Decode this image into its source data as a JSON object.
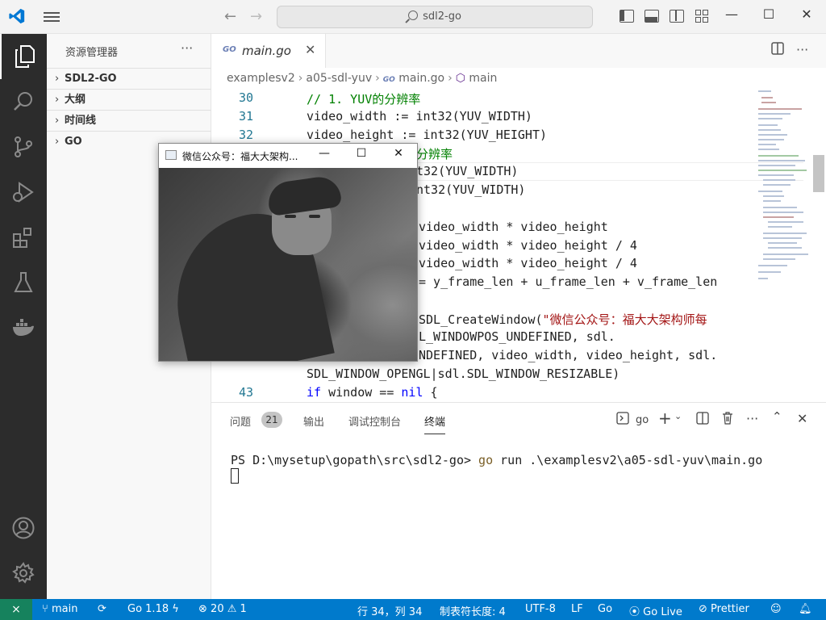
{
  "titlebar": {
    "search_text": "sdl2-go"
  },
  "sidebar": {
    "title": "资源管理器",
    "more": "···",
    "sections": [
      {
        "label": "SDL2-GO"
      },
      {
        "label": "大纲"
      },
      {
        "label": "时间线"
      },
      {
        "label": "GO"
      }
    ]
  },
  "tab": {
    "icon_text": "GO",
    "name": "main.go",
    "close": "✕"
  },
  "breadcrumb": {
    "items": [
      "examplesv2",
      "a05-sdl-yuv",
      "main.go",
      "main"
    ],
    "go_icon_text": "GO"
  },
  "editor": {
    "line_numbers": {
      "l30": "30",
      "l31": "31",
      "l32": "32",
      "l43": "43"
    },
    "lines": {
      "c30": "// 1. YUV的分辨率",
      "c31": "video_width := int32(YUV_WIDTH)",
      "c32": "video_height := int32(YUV_HEIGHT)",
      "c33": "分辨率",
      "c34": "t32(YUV_WIDTH)",
      "c35": "nt32(YUV_WIDTH)",
      "c37": "video_width * video_height",
      "c38": "video_width * video_height / 4",
      "c39": "video_width * video_height / 4",
      "c40": "= y_frame_len + u_frame_len + v_frame_len",
      "c42a": "SDL_CreateWindow(",
      "c42b": "\"微信公众号：福大大架构师每",
      "c42c": "L_WINDOWPOS_UNDEFINED, sdl.",
      "c42d": "NDEFINED, video_width, video_height, sdl.",
      "c42e": "SDL_WINDOW_OPENGL|sdl.SDL_WINDOW_RESIZABLE)",
      "c43kw1": "if",
      "c43a": " window == ",
      "c43kw2": "nil",
      "c43b": " {"
    }
  },
  "sdl_window": {
    "title": "微信公众号：福大大架构...",
    "minimize": "—",
    "maximize": "☐",
    "close": "✕"
  },
  "panel": {
    "tabs": [
      "问题",
      "输出",
      "调试控制台",
      "终端"
    ],
    "problems_count": "21",
    "active_tab": "终端",
    "terminal_shell": "go",
    "terminal_prompt": "PS D:\\mysetup\\gopath\\src\\sdl2-go> ",
    "terminal_cmd": "go",
    "terminal_args": " run .\\examplesv2\\a05-sdl-yuv\\main.go"
  },
  "status": {
    "branch": "main",
    "go_version": "Go 1.18",
    "errors": "20",
    "warnings": "1",
    "position": "行 34，列 34",
    "tab_size": "制表符长度: 4",
    "encoding": "UTF-8",
    "eol": "LF",
    "language": "Go",
    "live": "Go Live",
    "prettier": "Prettier"
  },
  "colors": {
    "status_bar": "#007acc",
    "remote": "#16825d",
    "activity_bar": "#2c2c2c",
    "comment": "#008000",
    "keyword": "#0000ff",
    "string": "#a31515"
  }
}
